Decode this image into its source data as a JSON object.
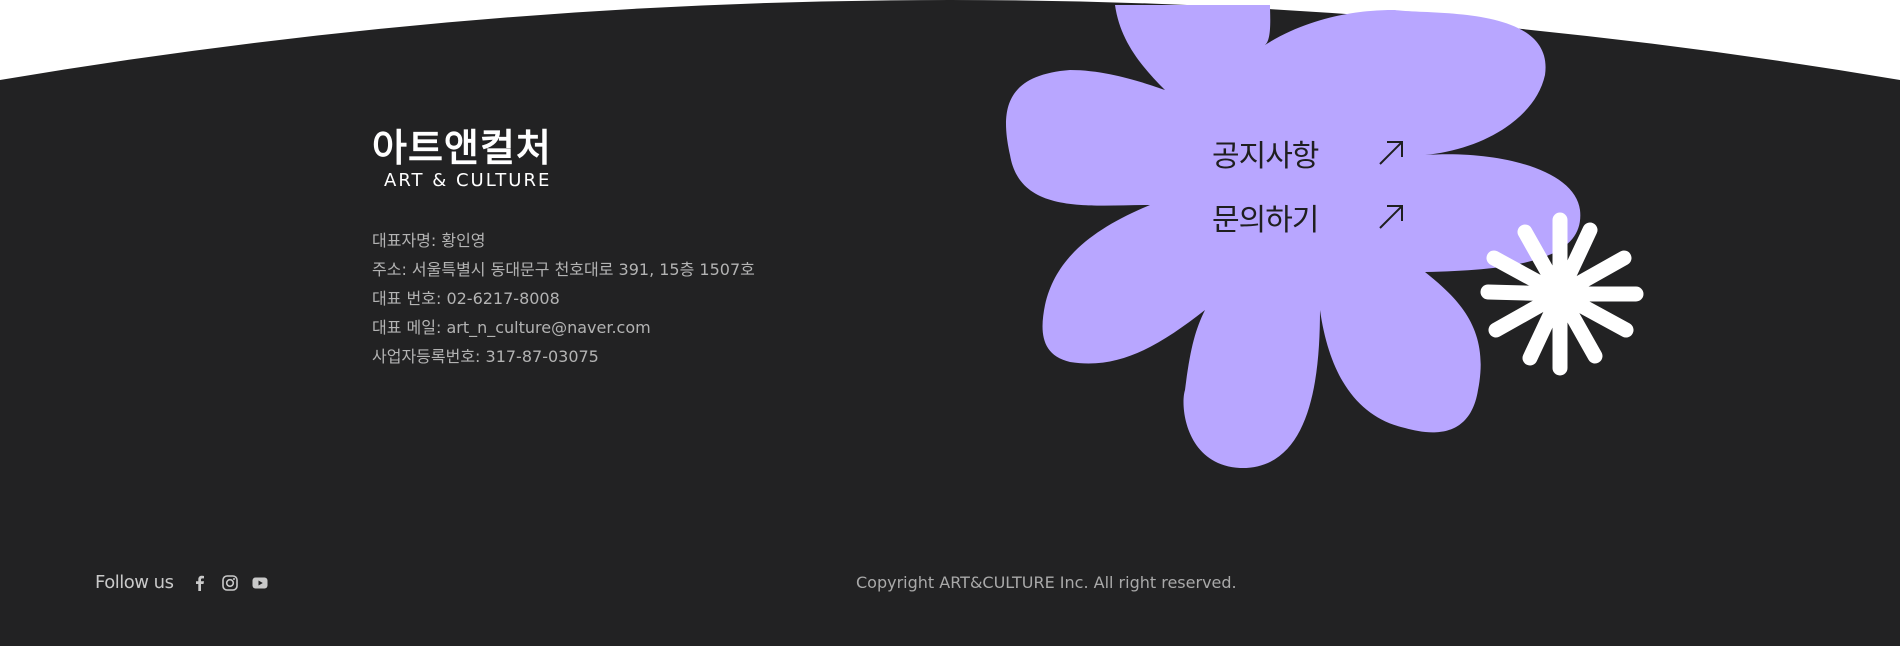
{
  "colors": {
    "background": "#222223",
    "flower": "#b8a6ff",
    "burst": "#ffffff",
    "text_muted": "#b3b3b3"
  },
  "logo": {
    "korean": "아트앤컬처",
    "english": "ART & CULTURE"
  },
  "company_info": [
    "대표자명: 황인영",
    "주소: 서울특별시 동대문구 천호대로 391, 15층 1507호",
    "대표 번호: 02-6217-8008",
    "대표 메일: art_n_culture@naver.com",
    "사업자등록번호: 317-87-03075"
  ],
  "menu": [
    {
      "label": "공지사항",
      "icon": "arrow-up-right-icon"
    },
    {
      "label": "문의하기",
      "icon": "arrow-up-right-icon"
    }
  ],
  "social": {
    "label": "Follow us",
    "icons": [
      "facebook-icon",
      "instagram-icon",
      "youtube-icon"
    ]
  },
  "copyright": "Copyright ART&CULTURE Inc. All right reserved."
}
